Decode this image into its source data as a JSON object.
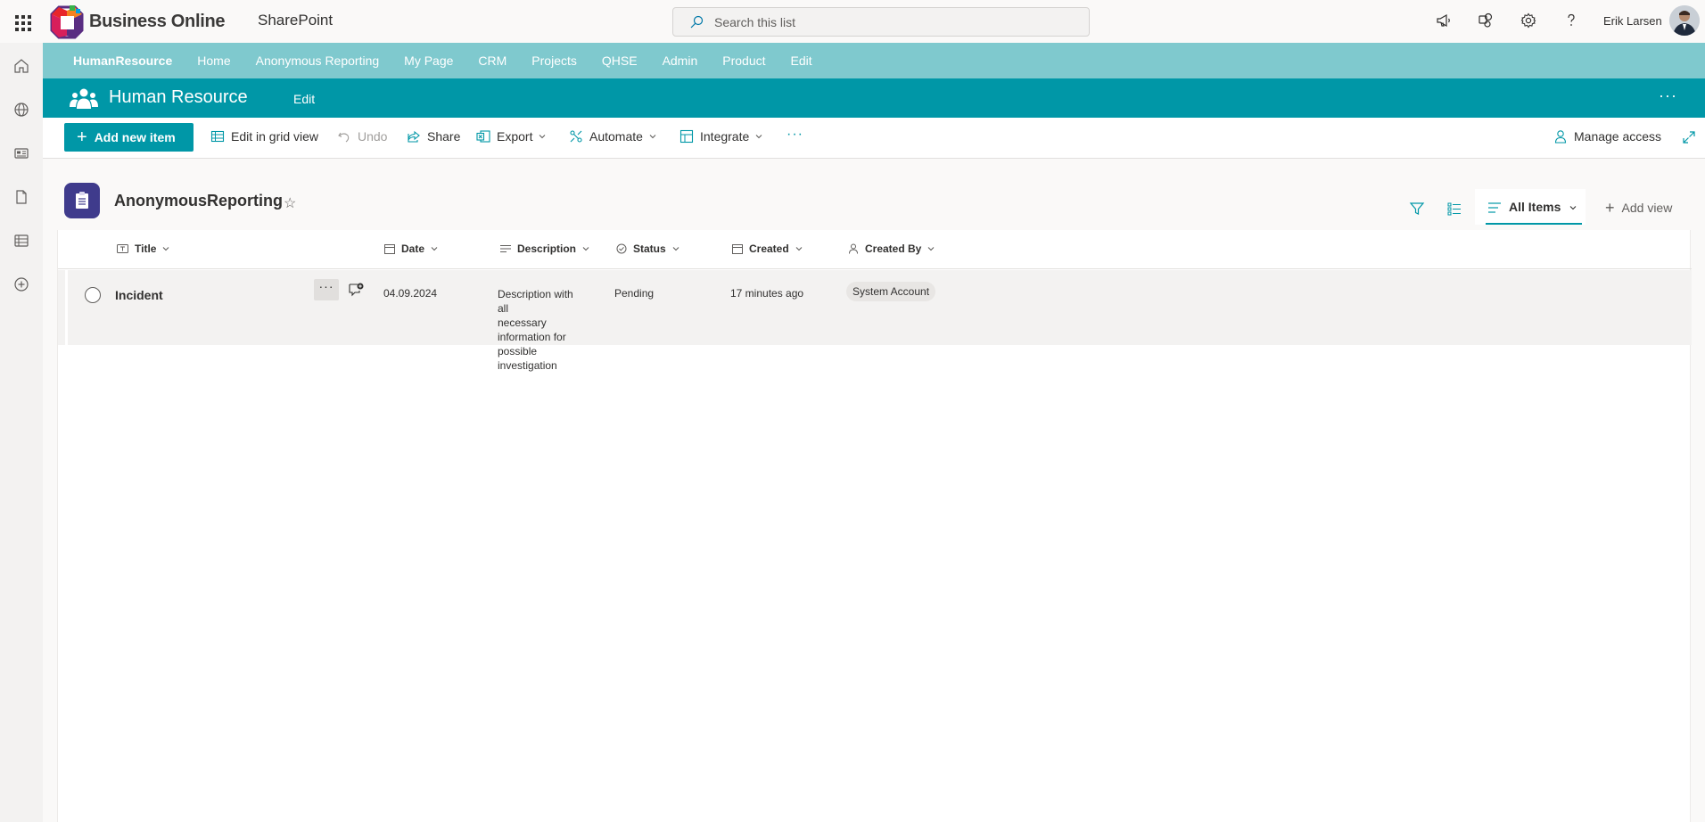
{
  "suite": {
    "brand": "Business Online",
    "app": "SharePoint",
    "search_placeholder": "Search this list",
    "user": "Erik Larsen"
  },
  "hub_nav": {
    "home": "HumanResource",
    "items": [
      "Home",
      "Anonymous Reporting",
      "My Page",
      "CRM",
      "Projects",
      "QHSE",
      "Admin",
      "Product",
      "Edit"
    ]
  },
  "site": {
    "title": "Human Resource",
    "edit": "Edit",
    "more": "···"
  },
  "commands": {
    "add_new": "Add new item",
    "edit_grid": "Edit in grid view",
    "undo": "Undo",
    "share": "Share",
    "export": "Export",
    "automate": "Automate",
    "integrate": "Integrate",
    "more": "···",
    "manage_access": "Manage access"
  },
  "list": {
    "title": "AnonymousReporting",
    "view": "All Items",
    "add_view": "Add view",
    "columns": {
      "title": "Title",
      "date": "Date",
      "description": "Description",
      "status": "Status",
      "created": "Created",
      "created_by": "Created By"
    },
    "rows": [
      {
        "title": "Incident",
        "more": "···",
        "date": "04.09.2024",
        "description_lines": [
          "Description with all",
          "necessary",
          "information for",
          "possible",
          "investigation"
        ],
        "status": "Pending",
        "created": "17 minutes ago",
        "created_by": "System Account"
      }
    ]
  },
  "colors": {
    "accent": "#0097a7",
    "hub_nav": "#7fc9ce",
    "list_icon": "#3f3b8c"
  }
}
